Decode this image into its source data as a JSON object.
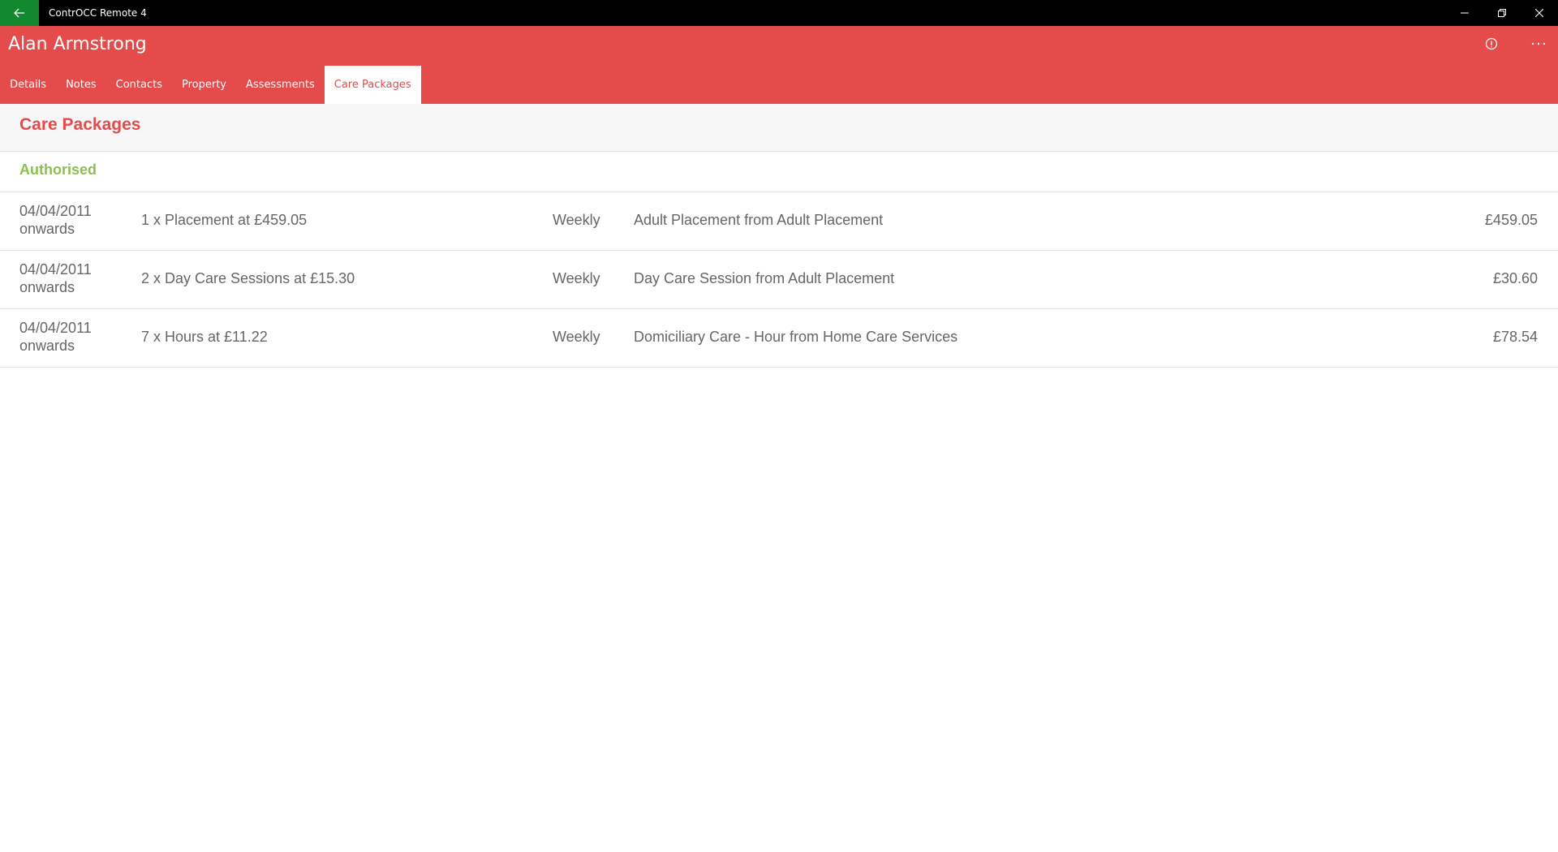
{
  "window": {
    "title": "ContrOCC Remote 4"
  },
  "header": {
    "client_name": "Alan Armstrong",
    "tabs": [
      {
        "label": "Details",
        "active": false
      },
      {
        "label": "Notes",
        "active": false
      },
      {
        "label": "Contacts",
        "active": false
      },
      {
        "label": "Property",
        "active": false
      },
      {
        "label": "Assessments",
        "active": false
      },
      {
        "label": "Care Packages",
        "active": true
      }
    ]
  },
  "section": {
    "title": "Care Packages",
    "group_title": "Authorised"
  },
  "packages": [
    {
      "date": "04/04/2011",
      "date_suffix": "onwards",
      "quantity": "1 x Placement at £459.05",
      "frequency": "Weekly",
      "description": "Adult Placement from Adult Placement",
      "amount": "£459.05"
    },
    {
      "date": "04/04/2011",
      "date_suffix": "onwards",
      "quantity": "2 x Day Care Sessions at £15.30",
      "frequency": "Weekly",
      "description": "Day Care Session from Adult Placement",
      "amount": "£30.60"
    },
    {
      "date": "04/04/2011",
      "date_suffix": "onwards",
      "quantity": "7 x Hours at £11.22",
      "frequency": "Weekly",
      "description": "Domiciliary Care - Hour from Home Care Services",
      "amount": "£78.54"
    }
  ],
  "colors": {
    "accent": "#e54b4b",
    "back_button": "#13892f",
    "authorised": "#8cbf4f"
  },
  "icons": {
    "back": "arrow-left-icon",
    "minimize": "minimize-icon",
    "restore": "restore-icon",
    "close": "close-icon",
    "info": "info-icon",
    "more": "more-icon"
  }
}
